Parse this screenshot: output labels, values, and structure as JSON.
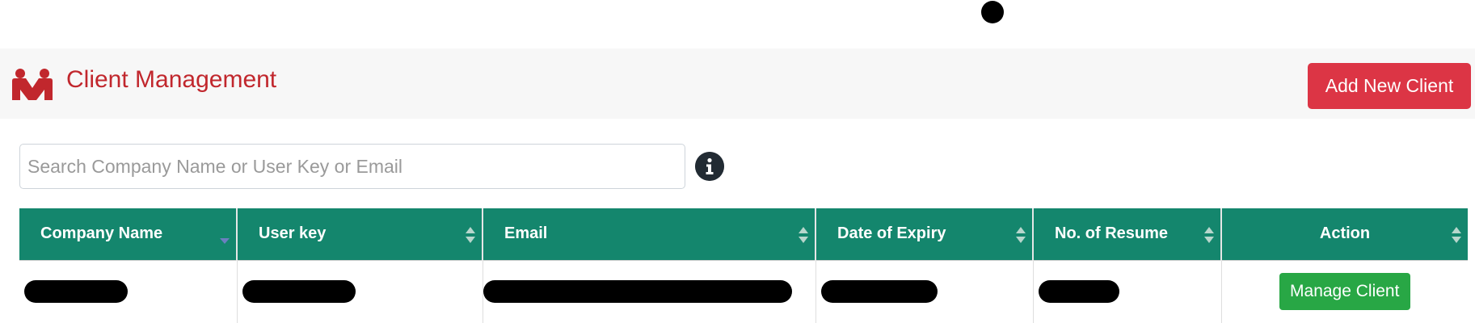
{
  "header": {
    "title": "Client Management",
    "add_button_label": "Add New Client",
    "brand_color": "#c1272d"
  },
  "search": {
    "placeholder": "Search Company Name or User Key or Email",
    "value": ""
  },
  "table": {
    "columns": [
      {
        "label": "Company Name",
        "sort": "descending"
      },
      {
        "label": "User key",
        "sort": "none"
      },
      {
        "label": "Email",
        "sort": "none"
      },
      {
        "label": "Date of Expiry",
        "sort": "none"
      },
      {
        "label": "No. of Resume",
        "sort": "none"
      },
      {
        "label": "Action",
        "sort": "none"
      }
    ],
    "rows": [
      {
        "action_label": "Manage Client"
      }
    ],
    "header_color": "#14866d"
  },
  "icons": {
    "brand": "people-icon",
    "info": "info-icon",
    "sort": "sort-arrows-icon"
  },
  "colors": {
    "danger": "#dc3545",
    "success": "#28a745"
  }
}
